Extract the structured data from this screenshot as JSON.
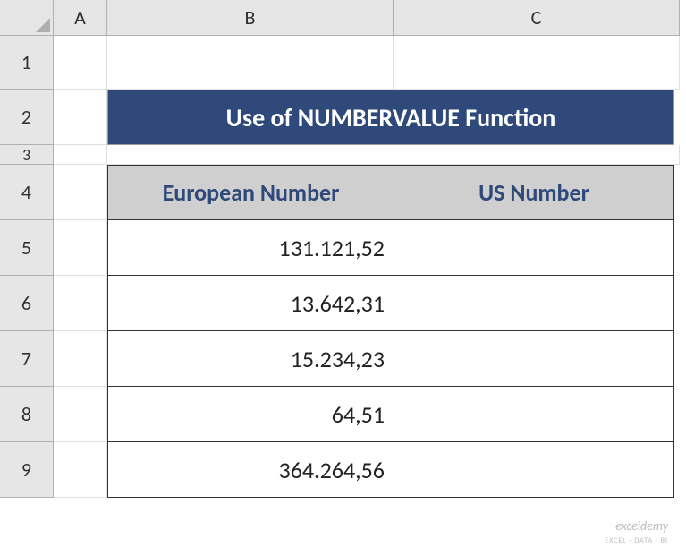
{
  "columns": {
    "A": "A",
    "B": "B",
    "C": "C"
  },
  "rows": {
    "1": "1",
    "2": "2",
    "3": "3",
    "4": "4",
    "5": "5",
    "6": "6",
    "7": "7",
    "8": "8",
    "9": "9"
  },
  "title": "Use of NUMBERVALUE Function",
  "headers": {
    "b": "European Number",
    "c": "US Number"
  },
  "data": {
    "b5": "131.121,52",
    "b6": "13.642,31",
    "b7": "15.234,23",
    "b8": "64,51",
    "b9": "364.264,56",
    "c5": "",
    "c6": "",
    "c7": "",
    "c8": "",
    "c9": ""
  },
  "watermark": {
    "main": "exceldemy",
    "sub": "EXCEL · DATA · BI"
  },
  "chart_data": {
    "type": "table",
    "title": "Use of NUMBERVALUE Function",
    "columns": [
      "European Number",
      "US Number"
    ],
    "rows": [
      [
        "131.121,52",
        ""
      ],
      [
        "13.642,31",
        ""
      ],
      [
        "15.234,23",
        ""
      ],
      [
        "64,51",
        ""
      ],
      [
        "364.264,56",
        ""
      ]
    ]
  }
}
